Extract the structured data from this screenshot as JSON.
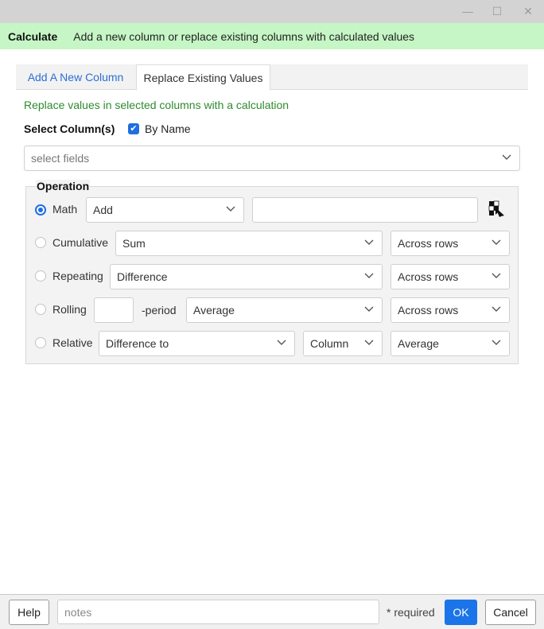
{
  "window": {
    "minimize_glyph": "—",
    "maximize_glyph": "☐",
    "close_glyph": "✕"
  },
  "banner": {
    "title": "Calculate",
    "description": "Add a new column or replace existing columns with calculated values",
    "background": "#c6f6c5"
  },
  "tabs": [
    {
      "label": "Add A New Column",
      "active": false
    },
    {
      "label": "Replace Existing Values",
      "active": true
    }
  ],
  "subtitle": "Replace values in selected columns with a calculation",
  "select_columns": {
    "label": "Select Column(s)",
    "by_name_label": "By Name",
    "by_name_checked": true,
    "fields_placeholder": "select fields"
  },
  "operation": {
    "legend": "Operation",
    "math": {
      "label": "Math",
      "selected": true,
      "op_value": "Add",
      "operand_value": ""
    },
    "cumulative": {
      "label": "Cumulative",
      "selected": false,
      "func_value": "Sum",
      "direction_value": "Across rows"
    },
    "repeating": {
      "label": "Repeating",
      "selected": false,
      "func_value": "Difference",
      "direction_value": "Across rows"
    },
    "rolling": {
      "label": "Rolling",
      "selected": false,
      "period_value": "",
      "period_suffix": "-period",
      "func_value": "Average",
      "direction_value": "Across rows"
    },
    "relative": {
      "label": "Relative",
      "selected": false,
      "func_value": "Difference to",
      "scope_value": "Column",
      "stat_value": "Average"
    }
  },
  "footer": {
    "help_label": "Help",
    "notes_placeholder": "notes",
    "required_label": "* required",
    "ok_label": "OK",
    "cancel_label": "Cancel"
  },
  "colors": {
    "accent": "#1b74e8",
    "tab_link": "#2b6fd6",
    "subtitle": "#2e8b2e"
  },
  "icons": {
    "picker": "column-picker-icon",
    "chevron": "chevron-down-icon"
  }
}
